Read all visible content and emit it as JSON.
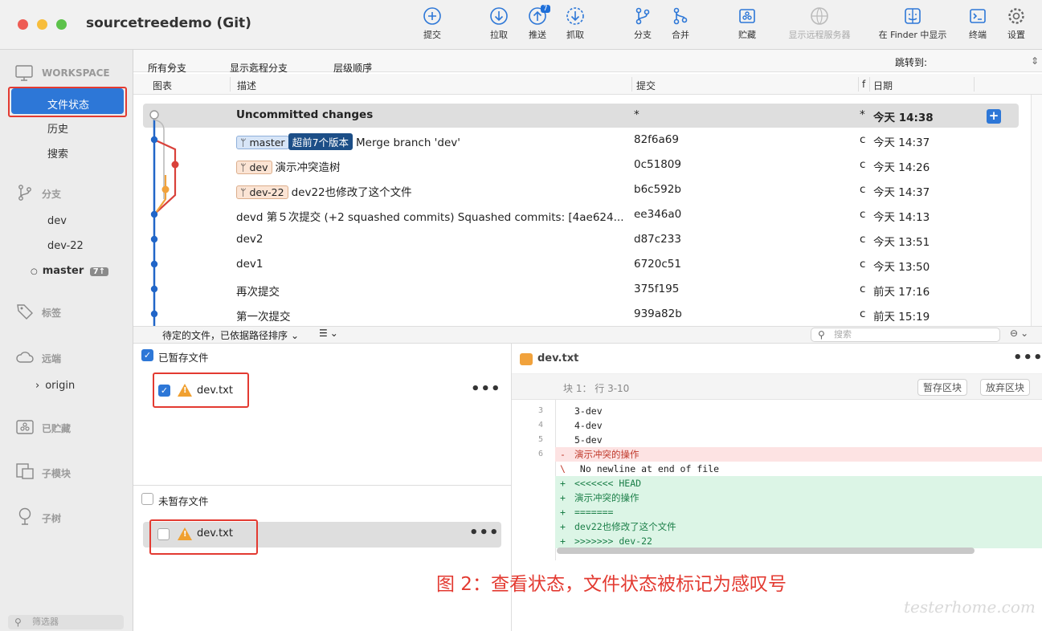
{
  "window": {
    "title": "sourcetreedemo (Git)"
  },
  "toolbar": {
    "commit": "提交",
    "pull": "拉取",
    "push": "推送",
    "push_badge": "7",
    "fetch": "抓取",
    "branch": "分支",
    "merge": "合并",
    "stash": "贮藏",
    "remote": "显示远程服务器",
    "finder": "在 Finder 中显示",
    "terminal": "终端",
    "settings": "设置"
  },
  "sidebar": {
    "workspace": "WORKSPACE",
    "file_status": "文件状态",
    "history": "历史",
    "search": "搜索",
    "branches_head": "分支",
    "branches": [
      "dev",
      "dev-22"
    ],
    "current_branch": "master",
    "current_badge": "7↑",
    "tags_head": "标签",
    "remotes_head": "远端",
    "remote_origin": "origin",
    "stashes_head": "已贮藏",
    "submodules_head": "子模块",
    "subtrees_head": "子树",
    "filter_placeholder": "筛选器"
  },
  "filterbar": {
    "all_branches": "所有分支",
    "show_remote": "显示远程分支",
    "order": "层级顺序",
    "jump": "跳转到:"
  },
  "columns": {
    "graph": "图表",
    "description": "描述",
    "commit": "提交",
    "author": "f",
    "date": "日期"
  },
  "commits": [
    {
      "tags": [],
      "desc": "Uncommitted changes",
      "hash": "*",
      "author": "*",
      "date": "今天 14:38"
    },
    {
      "tags": [
        {
          "label": "master",
          "style": "blue"
        },
        {
          "label": "超前7个版本",
          "style": "dark"
        }
      ],
      "desc": "Merge branch 'dev'",
      "hash": "82f6a69",
      "author": "c",
      "date": "今天 14:37"
    },
    {
      "tags": [
        {
          "label": "dev",
          "style": "orange"
        }
      ],
      "desc": "演示冲突造树",
      "hash": "0c51809",
      "author": "c",
      "date": "今天 14:26"
    },
    {
      "tags": [
        {
          "label": "dev-22",
          "style": "orange"
        }
      ],
      "desc": "dev22也修改了这个文件",
      "hash": "b6c592b",
      "author": "c",
      "date": "今天 14:37"
    },
    {
      "tags": [],
      "desc": "devd 第５次提交 (+2 squashed commits) Squashed commits: [4ae624...",
      "hash": "ee346a0",
      "author": "c",
      "date": "今天 14:13"
    },
    {
      "tags": [],
      "desc": "dev2",
      "hash": "d87c233",
      "author": "c",
      "date": "今天 13:51"
    },
    {
      "tags": [],
      "desc": "dev1",
      "hash": "6720c51",
      "author": "c",
      "date": "今天 13:50"
    },
    {
      "tags": [],
      "desc": "再次提交",
      "hash": "375f195",
      "author": "c",
      "date": "前天 17:16"
    },
    {
      "tags": [],
      "desc": "第一次提交",
      "hash": "939a82b",
      "author": "c",
      "date": "前天 15:19"
    }
  ],
  "midbar": {
    "sort": "待定的文件，已依据路径排序",
    "search_placeholder": "搜索"
  },
  "staged": {
    "header": "已暂存文件",
    "file": "dev.txt"
  },
  "unstaged": {
    "header": "未暂存文件",
    "file": "dev.txt"
  },
  "diff": {
    "file": "dev.txt",
    "hunk": "块 1：  行 3-10",
    "stage_hunk": "暂存区块",
    "discard_hunk": "放弃区块",
    "lines": [
      {
        "num": "3",
        "kind": "ctx",
        "sign": "",
        "text": "3-dev"
      },
      {
        "num": "4",
        "kind": "ctx",
        "sign": "",
        "text": "4-dev"
      },
      {
        "num": "5",
        "kind": "ctx",
        "sign": "",
        "text": "5-dev"
      },
      {
        "num": "6",
        "kind": "del",
        "sign": "-",
        "text": "演示冲突的操作"
      },
      {
        "num": "",
        "kind": "ctx",
        "sign": "\\",
        "text": " No newline at end of file"
      },
      {
        "num": "",
        "kind": "add",
        "sign": "+",
        "text": "<<<<<<< HEAD"
      },
      {
        "num": "",
        "kind": "add",
        "sign": "+",
        "text": "演示冲突的操作"
      },
      {
        "num": "",
        "kind": "add",
        "sign": "+",
        "text": "======="
      },
      {
        "num": "",
        "kind": "add",
        "sign": "+",
        "text": "dev22也修改了这个文件"
      },
      {
        "num": "",
        "kind": "add",
        "sign": "+",
        "text": ">>>>>>> dev-22"
      }
    ]
  },
  "caption": "图 2：查看状态，文件状态被标记为感叹号",
  "watermark": "testerhome.com",
  "colors": {
    "accent": "#2d77d7",
    "highlight": "#e33a31",
    "graph_blue": "#2166c8",
    "graph_red": "#d9413a",
    "graph_orange": "#f1a23c"
  }
}
